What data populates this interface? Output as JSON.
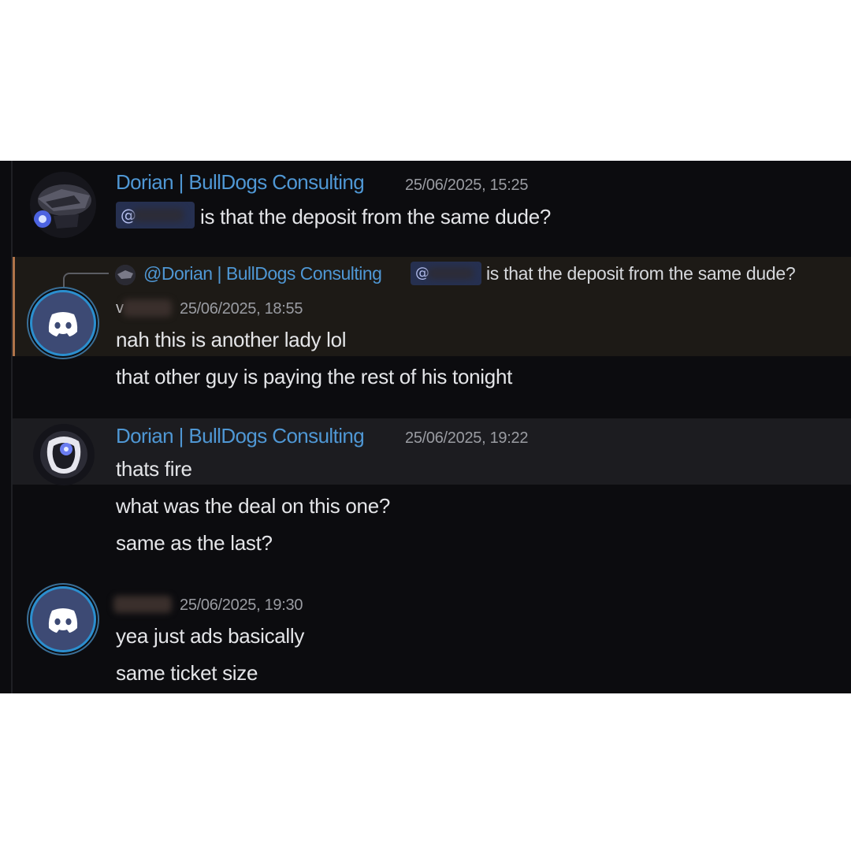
{
  "messages": [
    {
      "author": "Dorian | BullDogs Consulting",
      "timestamp": "25/06/2025, 15:25",
      "mention": "@",
      "text": "is that the deposit from the same dude?",
      "avatar_icon": "robot-mech-icon"
    },
    {
      "reply": {
        "author": "@Dorian | BullDogs Consulting",
        "mention": "@",
        "text": "is that the deposit from the same dude?"
      },
      "author": "v",
      "timestamp": "25/06/2025, 18:55",
      "lines": [
        "nah this is another lady lol",
        "that other guy is paying the rest of his tonight"
      ],
      "avatar_icon": "discord-logo-icon"
    },
    {
      "author": "Dorian | BullDogs Consulting",
      "timestamp": "25/06/2025, 19:22",
      "lines": [
        "thats fire",
        "what was the deal on this one?",
        "same as the last?"
      ],
      "avatar_icon": "robot-mech-icon"
    },
    {
      "author": "",
      "timestamp": "25/06/2025, 19:30",
      "lines": [
        "yea just ads basically",
        "same ticket size"
      ],
      "avatar_icon": "discord-logo-icon"
    }
  ],
  "colors": {
    "background": "#0c0c0f",
    "author": "#4f97d4",
    "reply_highlight": "#1d1a16",
    "reply_bar": "#b0744a"
  }
}
